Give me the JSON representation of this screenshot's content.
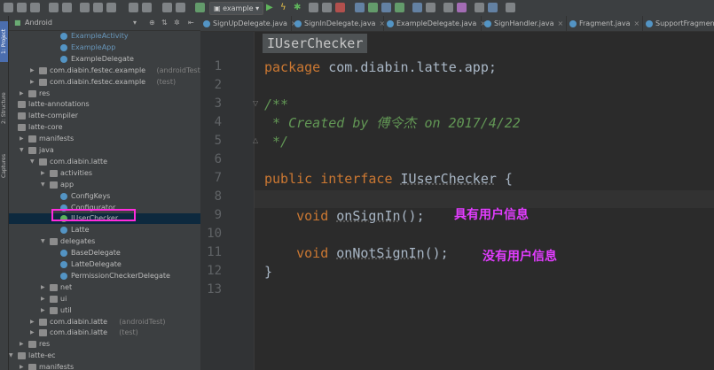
{
  "toolbar": {
    "run_config": "example"
  },
  "left_strip": {
    "tabs": [
      "1: Project",
      "2: Structure",
      "Captures"
    ]
  },
  "project_panel": {
    "view_mode": "Android",
    "tree": [
      {
        "label": "ExampleActivity",
        "sub": "",
        "indent": 4,
        "icon": "class",
        "color": "blue",
        "arrow": ""
      },
      {
        "label": "ExampleApp",
        "sub": "",
        "indent": 4,
        "icon": "class",
        "color": "blue",
        "arrow": ""
      },
      {
        "label": "ExampleDelegate",
        "sub": "",
        "indent": 4,
        "icon": "class",
        "color": "default",
        "arrow": ""
      },
      {
        "label": "com.diabin.festec.example",
        "sub": "(androidTest)",
        "indent": 2,
        "icon": "folder",
        "color": "default",
        "arrow": "right"
      },
      {
        "label": "com.diabin.festec.example",
        "sub": "(test)",
        "indent": 2,
        "icon": "folder",
        "color": "default",
        "arrow": "right"
      },
      {
        "label": "res",
        "sub": "",
        "indent": 1,
        "icon": "folder",
        "color": "default",
        "arrow": "right"
      },
      {
        "label": "latte-annotations",
        "sub": "",
        "indent": 0,
        "icon": "folder",
        "color": "default",
        "arrow": ""
      },
      {
        "label": "latte-compiler",
        "sub": "",
        "indent": 0,
        "icon": "folder",
        "color": "default",
        "arrow": ""
      },
      {
        "label": "latte-core",
        "sub": "",
        "indent": 0,
        "icon": "folder",
        "color": "default",
        "arrow": ""
      },
      {
        "label": "manifests",
        "sub": "",
        "indent": 1,
        "icon": "folder",
        "color": "default",
        "arrow": "right"
      },
      {
        "label": "java",
        "sub": "",
        "indent": 1,
        "icon": "folder",
        "color": "default",
        "arrow": "down"
      },
      {
        "label": "com.diabin.latte",
        "sub": "",
        "indent": 2,
        "icon": "folder",
        "color": "default",
        "arrow": "down"
      },
      {
        "label": "activities",
        "sub": "",
        "indent": 3,
        "icon": "folder",
        "color": "default",
        "arrow": "right"
      },
      {
        "label": "app",
        "sub": "",
        "indent": 3,
        "icon": "folder",
        "color": "default",
        "arrow": "down"
      },
      {
        "label": "ConfigKeys",
        "sub": "",
        "indent": 4,
        "icon": "class",
        "color": "default",
        "arrow": ""
      },
      {
        "label": "Configurator",
        "sub": "",
        "indent": 4,
        "icon": "class",
        "color": "default",
        "arrow": ""
      },
      {
        "label": "IUserChecker",
        "sub": "",
        "indent": 4,
        "icon": "interface",
        "color": "default",
        "arrow": "",
        "selected": true
      },
      {
        "label": "Latte",
        "sub": "",
        "indent": 4,
        "icon": "class",
        "color": "default",
        "arrow": ""
      },
      {
        "label": "delegates",
        "sub": "",
        "indent": 3,
        "icon": "folder",
        "color": "default",
        "arrow": "down"
      },
      {
        "label": "BaseDelegate",
        "sub": "",
        "indent": 4,
        "icon": "class",
        "color": "default",
        "arrow": ""
      },
      {
        "label": "LatteDelegate",
        "sub": "",
        "indent": 4,
        "icon": "class",
        "color": "default",
        "arrow": ""
      },
      {
        "label": "PermissionCheckerDelegate",
        "sub": "",
        "indent": 4,
        "icon": "class",
        "color": "default",
        "arrow": ""
      },
      {
        "label": "net",
        "sub": "",
        "indent": 3,
        "icon": "folder",
        "color": "default",
        "arrow": "right"
      },
      {
        "label": "ui",
        "sub": "",
        "indent": 3,
        "icon": "folder",
        "color": "default",
        "arrow": "right"
      },
      {
        "label": "util",
        "sub": "",
        "indent": 3,
        "icon": "folder",
        "color": "default",
        "arrow": "right"
      },
      {
        "label": "com.diabin.latte",
        "sub": "(androidTest)",
        "indent": 2,
        "icon": "folder",
        "color": "default",
        "arrow": "right"
      },
      {
        "label": "com.diabin.latte",
        "sub": "(test)",
        "indent": 2,
        "icon": "folder",
        "color": "default",
        "arrow": "right"
      },
      {
        "label": "res",
        "sub": "",
        "indent": 1,
        "icon": "folder",
        "color": "default",
        "arrow": "right"
      },
      {
        "label": "latte-ec",
        "sub": "",
        "indent": 0,
        "icon": "folder",
        "color": "default",
        "arrow": "down"
      },
      {
        "label": "manifests",
        "sub": "",
        "indent": 1,
        "icon": "folder",
        "color": "default",
        "arrow": "right"
      }
    ]
  },
  "tabs": [
    {
      "label": "SignUpDelegate.java",
      "active": false
    },
    {
      "label": "SignInDelegate.java",
      "active": false
    },
    {
      "label": "ExampleDelegate.java",
      "active": false
    },
    {
      "label": "SignHandler.java",
      "active": false
    },
    {
      "label": "Fragment.java",
      "active": false
    },
    {
      "label": "SupportFragment.java",
      "active": false
    }
  ],
  "editor": {
    "breadcrumb": "IUserChecker",
    "line_numbers": [
      "1",
      "2",
      "3",
      "4",
      "5",
      "6",
      "7",
      "8",
      "9",
      "10",
      "11",
      "12",
      "13"
    ],
    "code": {
      "package_kw": "package",
      "package_name": " com.diabin.latte.app;",
      "comment_open": "/**",
      "comment_created": " * Created by 傅令杰 on 2017/4/22",
      "comment_close": " */",
      "public_kw": "public",
      "interface_kw": " interface ",
      "iface_name": "IUserChecker",
      "brace_open": " {",
      "void1": "    void ",
      "method1": "onSignIn",
      "call1": "();",
      "void2": "    void ",
      "method2": "onNotSignIn",
      "call2": "();",
      "brace_close": "}"
    },
    "annotations": {
      "on_sign_in": "具有用户信息",
      "on_not_sign_in": "没有用户信息"
    }
  }
}
